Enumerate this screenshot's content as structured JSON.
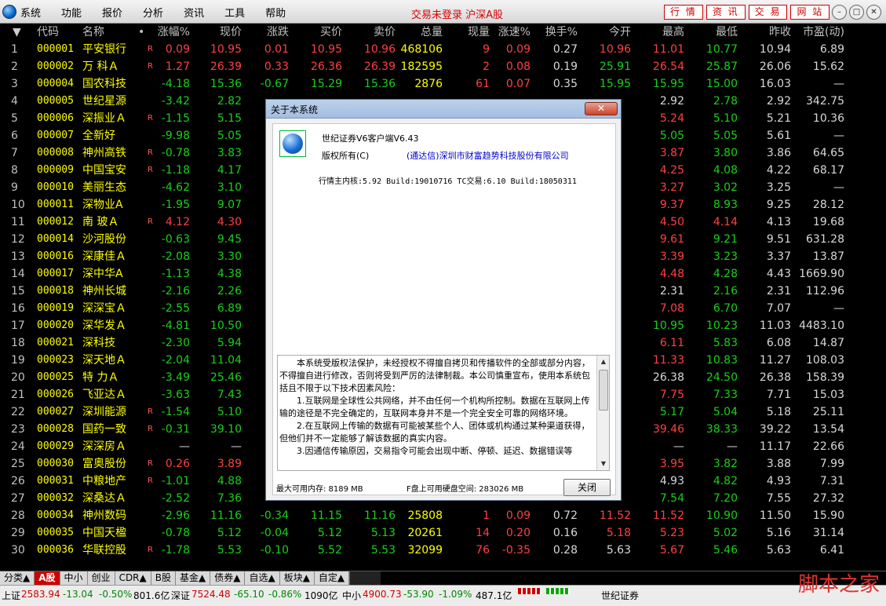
{
  "app": {
    "menu": [
      "系统",
      "功能",
      "报价",
      "分析",
      "资讯",
      "工具",
      "帮助"
    ],
    "trade_status": "交易未登录 沪深A股",
    "quick_buttons": [
      "行 情",
      "资 讯",
      "交 易",
      "网 站"
    ],
    "window_controls": [
      "–",
      "□",
      "✕"
    ]
  },
  "table": {
    "columns": [
      "代码",
      "名称",
      "•",
      "涨幅%",
      "现价",
      "涨跌",
      "买价",
      "卖价",
      "总量",
      "现量",
      "涨速%",
      "换手%",
      "今开",
      "最高",
      "最低",
      "昨收",
      "市盈(动)"
    ],
    "sort_arrow": "▼",
    "rows": [
      {
        "idx": "1",
        "code": "000001",
        "name": "平安银行",
        "flag": "R",
        "pct": "0.09",
        "price": "10.95",
        "chg": "0.01",
        "bid": "10.95",
        "ask": "10.96",
        "vol": "468106",
        "cur": "9",
        "spd": "0.09",
        "turn": "0.27",
        "open": "10.96",
        "high": "11.01",
        "low": "10.77",
        "prev": "10.94",
        "pe": "6.89",
        "dir": "up"
      },
      {
        "idx": "2",
        "code": "000002",
        "name": "万 科Ａ",
        "flag": "R",
        "pct": "1.27",
        "price": "26.39",
        "chg": "0.33",
        "bid": "26.36",
        "ask": "26.39",
        "vol": "182595",
        "cur": "2",
        "spd": "0.08",
        "turn": "0.19",
        "open": "25.91",
        "high": "26.54",
        "low": "25.87",
        "prev": "26.06",
        "pe": "15.62",
        "dir": "up"
      },
      {
        "idx": "3",
        "code": "000004",
        "name": "国农科技",
        "flag": "",
        "pct": "-4.18",
        "price": "15.36",
        "chg": "-0.67",
        "bid": "15.29",
        "ask": "15.36",
        "vol": "2876",
        "cur": "61",
        "spd": "0.07",
        "turn": "0.35",
        "open": "15.95",
        "high": "15.95",
        "low": "15.00",
        "prev": "16.03",
        "pe": "—",
        "dir": "dn"
      },
      {
        "idx": "4",
        "code": "000005",
        "name": "世纪星源",
        "flag": "",
        "pct": "-3.42",
        "price": "2.82",
        "chg": "",
        "bid": "",
        "ask": "",
        "vol": "",
        "cur": "",
        "spd": "",
        "turn": "",
        "open": "",
        "high": "2.92",
        "low": "2.78",
        "prev": "2.92",
        "pe": "342.75",
        "dir": "dn"
      },
      {
        "idx": "5",
        "code": "000006",
        "name": "深振业Ａ",
        "flag": "R",
        "pct": "-1.15",
        "price": "5.15",
        "chg": "",
        "bid": "",
        "ask": "",
        "vol": "",
        "cur": "",
        "spd": "",
        "turn": "",
        "open": "",
        "high": "5.24",
        "low": "5.10",
        "prev": "5.21",
        "pe": "10.36",
        "dir": "dn"
      },
      {
        "idx": "6",
        "code": "000007",
        "name": "全新好",
        "flag": "",
        "pct": "-9.98",
        "price": "5.05",
        "chg": "",
        "bid": "",
        "ask": "",
        "vol": "",
        "cur": "",
        "spd": "",
        "turn": "",
        "open": "",
        "high": "5.05",
        "low": "5.05",
        "prev": "5.61",
        "pe": "—",
        "dir": "dn"
      },
      {
        "idx": "7",
        "code": "000008",
        "name": "神州高铁",
        "flag": "R",
        "pct": "-0.78",
        "price": "3.83",
        "chg": "",
        "bid": "",
        "ask": "",
        "vol": "",
        "cur": "",
        "spd": "",
        "turn": "",
        "open": "",
        "high": "3.87",
        "low": "3.80",
        "prev": "3.86",
        "pe": "64.65",
        "dir": "dn"
      },
      {
        "idx": "8",
        "code": "000009",
        "name": "中国宝安",
        "flag": "R",
        "pct": "-1.18",
        "price": "4.17",
        "chg": "",
        "bid": "",
        "ask": "",
        "vol": "",
        "cur": "",
        "spd": "",
        "turn": "",
        "open": "",
        "high": "4.25",
        "low": "4.08",
        "prev": "4.22",
        "pe": "68.17",
        "dir": "dn"
      },
      {
        "idx": "9",
        "code": "000010",
        "name": "美丽生态",
        "flag": "",
        "pct": "-4.62",
        "price": "3.10",
        "chg": "",
        "bid": "",
        "ask": "",
        "vol": "",
        "cur": "",
        "spd": "",
        "turn": "",
        "open": "",
        "high": "3.27",
        "low": "3.02",
        "prev": "3.25",
        "pe": "—",
        "dir": "dn"
      },
      {
        "idx": "10",
        "code": "000011",
        "name": "深物业A",
        "flag": "",
        "pct": "-1.95",
        "price": "9.07",
        "chg": "",
        "bid": "",
        "ask": "",
        "vol": "",
        "cur": "",
        "spd": "",
        "turn": "",
        "open": "",
        "high": "9.37",
        "low": "8.93",
        "prev": "9.25",
        "pe": "28.12",
        "dir": "dn"
      },
      {
        "idx": "11",
        "code": "000012",
        "name": "南 玻Ａ",
        "flag": "R",
        "pct": "4.12",
        "price": "4.30",
        "chg": "",
        "bid": "",
        "ask": "",
        "vol": "",
        "cur": "",
        "spd": "",
        "turn": "",
        "open": "",
        "high": "4.50",
        "low": "4.14",
        "prev": "4.13",
        "pe": "19.68",
        "dir": "up"
      },
      {
        "idx": "12",
        "code": "000014",
        "name": "沙河股份",
        "flag": "",
        "pct": "-0.63",
        "price": "9.45",
        "chg": "",
        "bid": "",
        "ask": "",
        "vol": "",
        "cur": "",
        "spd": "",
        "turn": "",
        "open": "",
        "high": "9.61",
        "low": "9.21",
        "prev": "9.51",
        "pe": "631.28",
        "dir": "dn"
      },
      {
        "idx": "13",
        "code": "000016",
        "name": "深康佳Ａ",
        "flag": "",
        "pct": "-2.08",
        "price": "3.30",
        "chg": "",
        "bid": "",
        "ask": "",
        "vol": "",
        "cur": "",
        "spd": "",
        "turn": "",
        "open": "",
        "high": "3.39",
        "low": "3.23",
        "prev": "3.37",
        "pe": "13.87",
        "dir": "dn"
      },
      {
        "idx": "14",
        "code": "000017",
        "name": "深中华A",
        "flag": "",
        "pct": "-1.13",
        "price": "4.38",
        "chg": "",
        "bid": "",
        "ask": "",
        "vol": "",
        "cur": "",
        "spd": "",
        "turn": "",
        "open": "",
        "high": "4.48",
        "low": "4.28",
        "prev": "4.43",
        "pe": "1669.90",
        "dir": "dn"
      },
      {
        "idx": "15",
        "code": "000018",
        "name": "神州长城",
        "flag": "",
        "pct": "-2.16",
        "price": "2.26",
        "chg": "",
        "bid": "",
        "ask": "",
        "vol": "",
        "cur": "",
        "spd": "",
        "turn": "",
        "open": "",
        "high": "2.31",
        "low": "2.16",
        "prev": "2.31",
        "pe": "112.96",
        "dir": "dn"
      },
      {
        "idx": "16",
        "code": "000019",
        "name": "深深宝Ａ",
        "flag": "",
        "pct": "-2.55",
        "price": "6.89",
        "chg": "",
        "bid": "",
        "ask": "",
        "vol": "",
        "cur": "",
        "spd": "",
        "turn": "",
        "open": "",
        "high": "7.08",
        "low": "6.70",
        "prev": "7.07",
        "pe": "—",
        "dir": "dn"
      },
      {
        "idx": "17",
        "code": "000020",
        "name": "深华发Ａ",
        "flag": "",
        "pct": "-4.81",
        "price": "10.50",
        "chg": "",
        "bid": "",
        "ask": "",
        "vol": "",
        "cur": "",
        "spd": "",
        "turn": "",
        "open": "",
        "high": "10.95",
        "low": "10.23",
        "prev": "11.03",
        "pe": "4483.10",
        "dir": "dn"
      },
      {
        "idx": "18",
        "code": "000021",
        "name": "深科技",
        "flag": "",
        "pct": "-2.30",
        "price": "5.94",
        "chg": "",
        "bid": "",
        "ask": "",
        "vol": "",
        "cur": "",
        "spd": "",
        "turn": "",
        "open": "",
        "high": "6.11",
        "low": "5.83",
        "prev": "6.08",
        "pe": "14.87",
        "dir": "dn"
      },
      {
        "idx": "19",
        "code": "000023",
        "name": "深天地Ａ",
        "flag": "",
        "pct": "-2.04",
        "price": "11.04",
        "chg": "",
        "bid": "",
        "ask": "",
        "vol": "",
        "cur": "",
        "spd": "",
        "turn": "",
        "open": "",
        "high": "11.33",
        "low": "10.83",
        "prev": "11.27",
        "pe": "108.03",
        "dir": "dn"
      },
      {
        "idx": "20",
        "code": "000025",
        "name": "特 力Ａ",
        "flag": "",
        "pct": "-3.49",
        "price": "25.46",
        "chg": "",
        "bid": "",
        "ask": "",
        "vol": "",
        "cur": "",
        "spd": "",
        "turn": "",
        "open": "",
        "high": "26.38",
        "low": "24.50",
        "prev": "26.38",
        "pe": "158.39",
        "dir": "dn"
      },
      {
        "idx": "21",
        "code": "000026",
        "name": "飞亚达Ａ",
        "flag": "",
        "pct": "-3.63",
        "price": "7.43",
        "chg": "",
        "bid": "",
        "ask": "",
        "vol": "",
        "cur": "",
        "spd": "",
        "turn": "",
        "open": "",
        "high": "7.75",
        "low": "7.33",
        "prev": "7.71",
        "pe": "15.03",
        "dir": "dn"
      },
      {
        "idx": "22",
        "code": "000027",
        "name": "深圳能源",
        "flag": "R",
        "pct": "-1.54",
        "price": "5.10",
        "chg": "",
        "bid": "",
        "ask": "",
        "vol": "",
        "cur": "",
        "spd": "",
        "turn": "",
        "open": "",
        "high": "5.17",
        "low": "5.04",
        "prev": "5.18",
        "pe": "25.11",
        "dir": "dn"
      },
      {
        "idx": "23",
        "code": "000028",
        "name": "国药一致",
        "flag": "R",
        "pct": "-0.31",
        "price": "39.10",
        "chg": "",
        "bid": "",
        "ask": "",
        "vol": "",
        "cur": "",
        "spd": "",
        "turn": "",
        "open": "",
        "high": "39.46",
        "low": "38.33",
        "prev": "39.22",
        "pe": "13.54",
        "dir": "dn"
      },
      {
        "idx": "24",
        "code": "000029",
        "name": "深深房Ａ",
        "flag": "",
        "pct": "—",
        "price": "—",
        "chg": "",
        "bid": "",
        "ask": "",
        "vol": "",
        "cur": "",
        "spd": "",
        "turn": "",
        "open": "",
        "high": "—",
        "low": "—",
        "prev": "11.17",
        "pe": "22.66",
        "dir": "eq"
      },
      {
        "idx": "25",
        "code": "000030",
        "name": "富奥股份",
        "flag": "R",
        "pct": "0.26",
        "price": "3.89",
        "chg": "",
        "bid": "",
        "ask": "",
        "vol": "",
        "cur": "",
        "spd": "",
        "turn": "",
        "open": "",
        "high": "3.95",
        "low": "3.82",
        "prev": "3.88",
        "pe": "7.99",
        "dir": "up"
      },
      {
        "idx": "26",
        "code": "000031",
        "name": "中粮地产",
        "flag": "R",
        "pct": "-1.01",
        "price": "4.88",
        "chg": "",
        "bid": "",
        "ask": "",
        "vol": "",
        "cur": "",
        "spd": "",
        "turn": "",
        "open": "",
        "high": "4.93",
        "low": "4.82",
        "prev": "4.93",
        "pe": "7.31",
        "dir": "dn"
      },
      {
        "idx": "27",
        "code": "000032",
        "name": "深桑达Ａ",
        "flag": "",
        "pct": "-2.52",
        "price": "7.36",
        "chg": "",
        "bid": "",
        "ask": "",
        "vol": "",
        "cur": "",
        "spd": "",
        "turn": "",
        "open": "",
        "high": "7.54",
        "low": "7.20",
        "prev": "7.55",
        "pe": "27.32",
        "dir": "dn"
      },
      {
        "idx": "28",
        "code": "000034",
        "name": "神州数码",
        "flag": "",
        "pct": "-2.96",
        "price": "11.16",
        "chg": "-0.34",
        "bid": "11.15",
        "ask": "11.16",
        "vol": "25808",
        "cur": "1",
        "spd": "0.09",
        "turn": "0.72",
        "open": "11.52",
        "high": "11.52",
        "low": "10.90",
        "prev": "11.50",
        "pe": "15.90",
        "dir": "dn"
      },
      {
        "idx": "29",
        "code": "000035",
        "name": "中国天楹",
        "flag": "",
        "pct": "-0.78",
        "price": "5.12",
        "chg": "-0.04",
        "bid": "5.12",
        "ask": "5.13",
        "vol": "20261",
        "cur": "14",
        "spd": "0.20",
        "turn": "0.16",
        "open": "5.18",
        "high": "5.23",
        "low": "5.02",
        "prev": "5.16",
        "pe": "31.14",
        "dir": "dn"
      },
      {
        "idx": "30",
        "code": "000036",
        "name": "华联控股",
        "flag": "R",
        "pct": "-1.78",
        "price": "5.53",
        "chg": "-0.10",
        "bid": "5.52",
        "ask": "5.53",
        "vol": "32099",
        "cur": "76",
        "spd": "-0.35",
        "turn": "0.28",
        "open": "5.63",
        "high": "5.67",
        "low": "5.46",
        "prev": "5.63",
        "pe": "6.41",
        "dir": "dn"
      }
    ]
  },
  "tabs": [
    "分类▲",
    "A股",
    "中小",
    "创业",
    "CDR▲",
    "B股",
    "基金▲",
    "债券▲",
    "自选▲",
    "板块▲",
    "自定▲"
  ],
  "active_tab": "A股",
  "status": {
    "sh_label": "上证",
    "sh_val": "2583.94",
    "sh_chg": "-13.04",
    "sh_pct": "-0.50%",
    "sh_amt": "801.6亿",
    "sz_label": "深证",
    "sz_val": "7524.48",
    "sz_chg": "-65.10",
    "sz_pct": "-0.86%",
    "sz_amt": "1090亿",
    "zx_label": "中小",
    "zx_val": "4900.73",
    "zx_chg": "-53.90",
    "zx_pct": "-1.09%",
    "zx_amt": "487.1亿",
    "broker": "世纪证券",
    "watermark": "脚本之家"
  },
  "dialog": {
    "title": "关于本系统",
    "close_glyph": "✕",
    "product": "世纪证券V6客户端V6.43",
    "copyright_label": "版权所有(C)",
    "company": "(通达信)深圳市财富趋势科技股份有限公司",
    "version": "行情主内核:5.92 Build:19010716 TC交易:6.10 Build:18050311",
    "license": [
      "本系统受版权法保护，未经授权不得擅自拷贝和传播软件的全部或部分内容，不得擅自进行修改，否则将受到严厉的法律制裁。本公司慎重宣布，使用本系统包括且不限于以下技术因素风险：",
      "1.互联网是全球性公共网络，并不由任何一个机构所控制。数据在互联网上传输的途径是不完全确定的，互联网本身并不是一个完全安全可靠的网络环境。",
      "2.在互联网上传输的数据有可能被某些个人、团体或机构通过某种渠道获得，但他们并不一定能够了解该数据的真实内容。",
      "3.因通信传输原因，交易指令可能会出现中断、停顿、延迟、数据错误等"
    ],
    "mem": "最大可用内存: 8189 MB",
    "disk": "F盘上可用硬盘空间: 283026 MB",
    "ok_label": "关闭"
  }
}
